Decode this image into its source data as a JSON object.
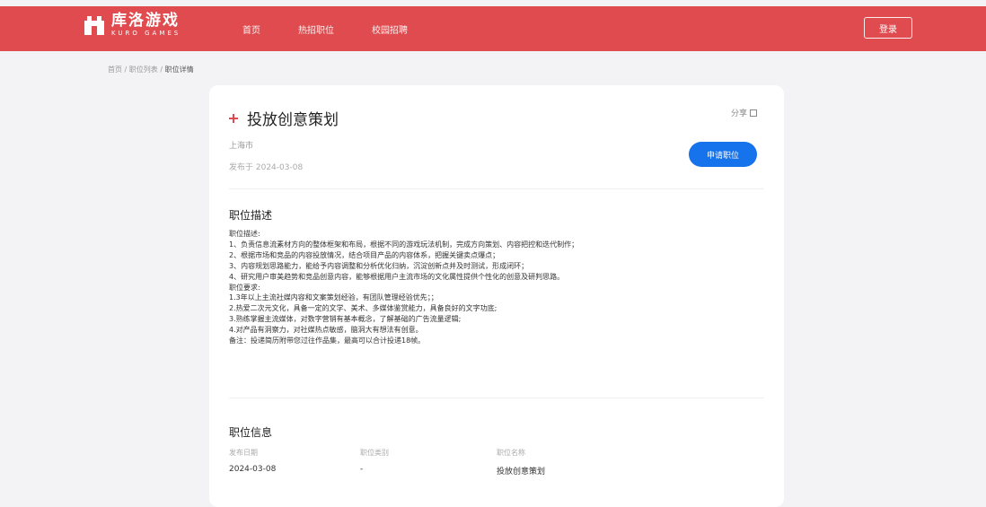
{
  "header": {
    "logo_cn": "库洛游戏",
    "logo_en": "KURO GAMES",
    "nav": [
      "首页",
      "热招职位",
      "校园招聘"
    ],
    "login_label": "登录"
  },
  "breadcrumb": {
    "items": [
      "首页",
      "职位列表"
    ],
    "separator": "/",
    "current": "职位详情"
  },
  "job": {
    "title": "投放创意策划",
    "share_label": "分享",
    "location": "上海市",
    "posted": "发布于 2024-03-08",
    "apply_label": "申请职位"
  },
  "description": {
    "section_title": "职位描述",
    "lines": [
      "职位描述:",
      "1、负责信息流素材方向的整体框架和布局，根据不同的游戏玩法机制，完成方向策划、内容把控和迭代制作；",
      "2、根据市场和竞品的内容投放情况，结合项目产品的内容体系，把握关键卖点爆点；",
      "3、内容规划思路能力，能给予内容调整和分析优化归纳，沉淀创新点并及时测试，形成闭环；",
      "4、研究用户审美趋势和竞品创意内容，能够根据用户主流市场的文化属性提供个性化的创意及研判思路。",
      "职位要求:",
      "1.3年以上主流社媒内容和文案策划经验，有团队管理经验优先；；",
      "2.热爱二次元文化，具备一定的文学、美术、多媒体鉴赏能力，具备良好的文字功底;",
      "3.熟练掌握主流媒体，对数字营销有基本概念，了解基础的广告流量逻辑;",
      "4.对产品有洞察力，对社媒热点敏感，脑洞大有想法有创意。",
      "备注：投递简历附带您过往作品集，最高可以合计投递18帧。"
    ]
  },
  "info": {
    "section_title": "职位信息",
    "columns": [
      {
        "label": "发布日期",
        "value": "2024-03-08"
      },
      {
        "label": "职位类别",
        "value": "-"
      },
      {
        "label": "职位名称",
        "value": "投放创意策划"
      }
    ]
  },
  "colors": {
    "header_red": "#df4b4f",
    "apply_blue": "#1673ec",
    "title_mark": "#e0494e"
  }
}
